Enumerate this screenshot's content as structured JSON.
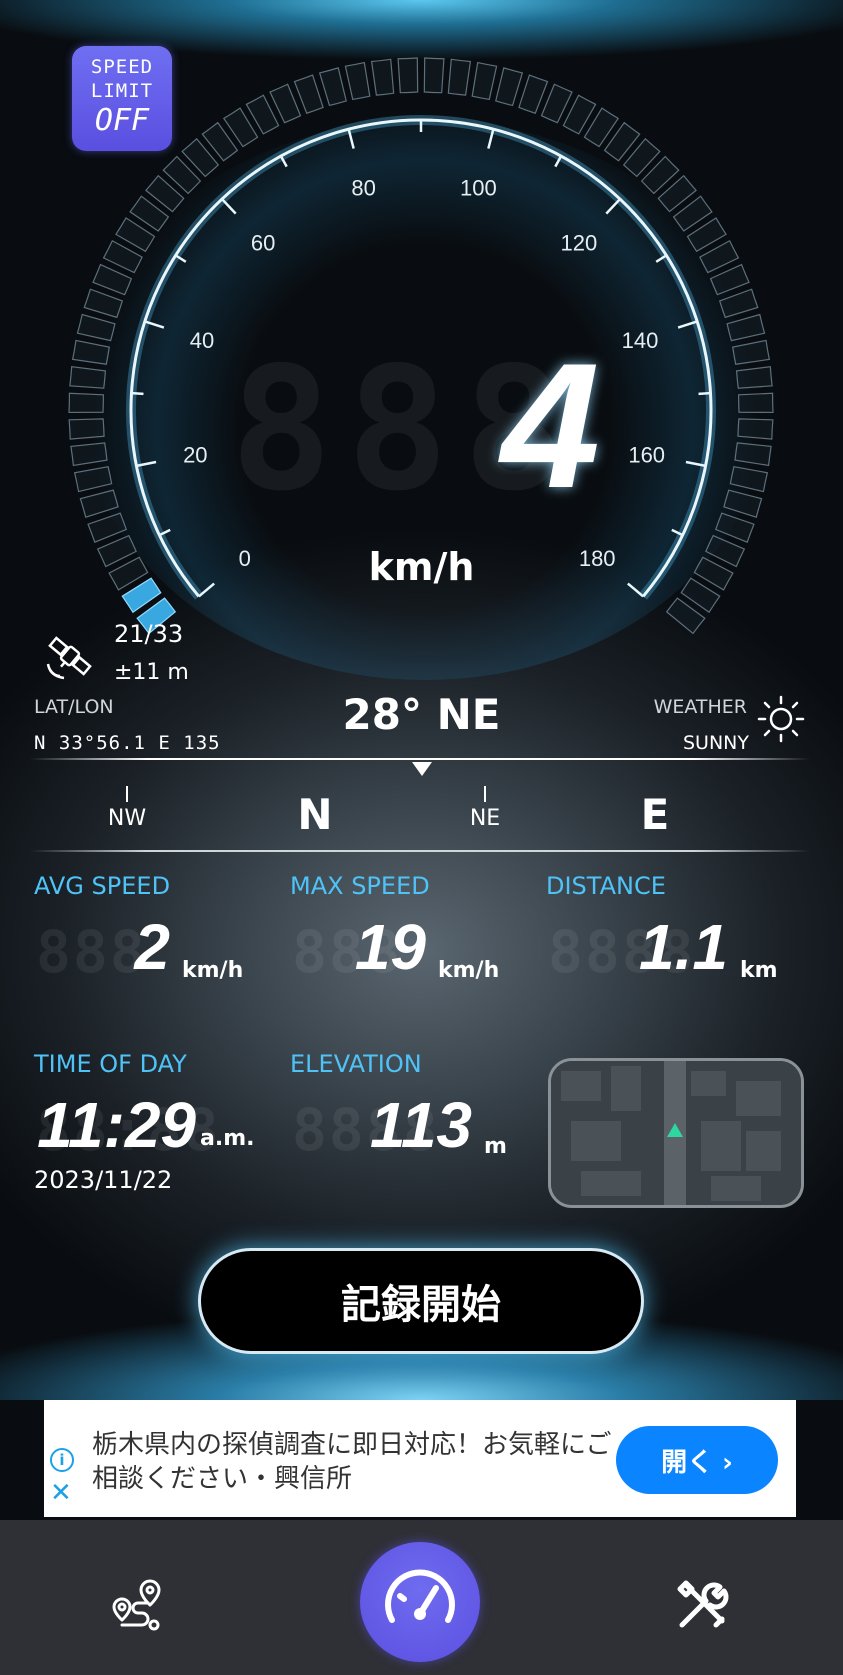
{
  "speed_limit": {
    "line1": "SPEED",
    "line2": "LIMIT",
    "state": "OFF"
  },
  "gauge": {
    "ticks": [
      "0",
      "20",
      "40",
      "60",
      "80",
      "100",
      "120",
      "140",
      "160",
      "180"
    ],
    "max": 180,
    "current_speed": "4",
    "current_speed_value": 4,
    "ghost_digits": "888",
    "unit": "km/h"
  },
  "gps": {
    "satellites": "21/33",
    "accuracy": "±11 m"
  },
  "location": {
    "label": "LAT/LON",
    "value": "N 33°56.1 E 135"
  },
  "heading": "28° NE",
  "weather": {
    "label": "WEATHER",
    "value": "SUNNY",
    "icon": "sun-icon"
  },
  "compass": {
    "marks": [
      "NW",
      "N",
      "NE",
      "E"
    ]
  },
  "stats": {
    "avg_speed": {
      "label": "AVG SPEED",
      "value": "2",
      "unit": "km/h"
    },
    "max_speed": {
      "label": "MAX SPEED",
      "value": "19",
      "unit": "km/h"
    },
    "distance": {
      "label": "DISTANCE",
      "value": "1.1",
      "unit": "km"
    },
    "time_of_day": {
      "label": "TIME OF DAY",
      "value": "11:29",
      "unit": "a.m.",
      "date": "2023/11/22"
    },
    "elevation": {
      "label": "ELEVATION",
      "value": "113",
      "unit": "m"
    }
  },
  "record_button": "記録開始",
  "ad": {
    "text": "栃木県内の探偵調査に即日対応！お気軽にご相談ください・興信所",
    "button": "開く ›",
    "info": "i",
    "close": "✕"
  },
  "colors": {
    "accent": "#4fc3f7",
    "brand": "#5b4fe0",
    "ad_button": "#0a84ff"
  },
  "tabbar": {
    "icons": [
      "route-icon",
      "speedometer-icon",
      "tools-icon"
    ]
  }
}
